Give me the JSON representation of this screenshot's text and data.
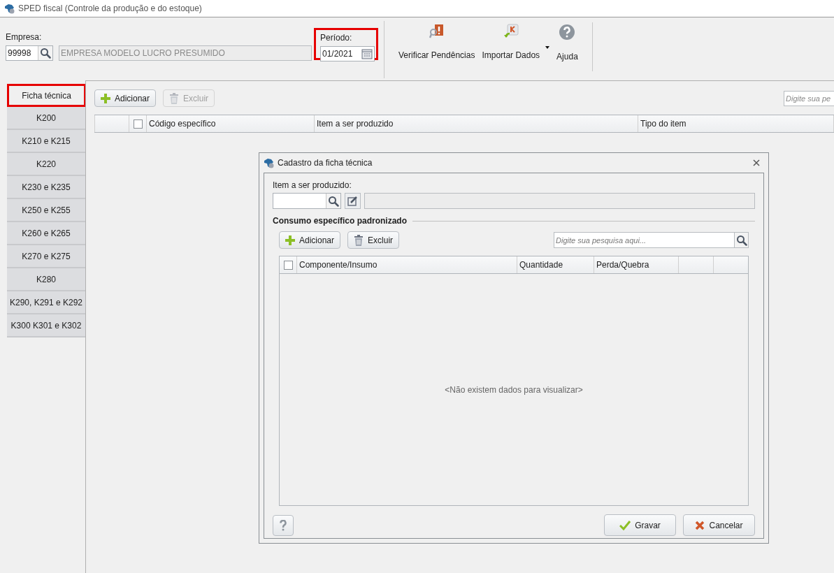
{
  "window": {
    "title": "SPED fiscal (Controle da produção e do estoque)"
  },
  "empresa": {
    "label": "Empresa:",
    "code": "99998",
    "name": "EMPRESA MODELO LUCRO PRESUMIDO"
  },
  "periodo": {
    "label": "Período:",
    "value": "01/2021",
    "highlighted": true
  },
  "toolbar": [
    {
      "kind": "pendencias",
      "label": "Verificar Pendências",
      "dropdown": false
    },
    {
      "kind": "import",
      "label": "Importar Dados",
      "dropdown": true
    },
    {
      "kind": "help",
      "label": "Ajuda",
      "dropdown": false
    }
  ],
  "side_tabs": [
    {
      "label": "Ficha técnica",
      "selected": true,
      "highlighted": true
    },
    {
      "label": "K200",
      "selected": false,
      "highlighted": false
    },
    {
      "label": "K210 e K215",
      "selected": false,
      "highlighted": false
    },
    {
      "label": "K220",
      "selected": false,
      "highlighted": false
    },
    {
      "label": "K230 e K235",
      "selected": false,
      "highlighted": false
    },
    {
      "label": "K250 e K255",
      "selected": false,
      "highlighted": false
    },
    {
      "label": "K260 e K265",
      "selected": false,
      "highlighted": false
    },
    {
      "label": "K270 e K275",
      "selected": false,
      "highlighted": false
    },
    {
      "label": "K280",
      "selected": false,
      "highlighted": false
    },
    {
      "label": "K290, K291 e K292",
      "selected": false,
      "highlighted": false
    },
    {
      "label": "K300 K301 e K302",
      "selected": false,
      "highlighted": false
    }
  ],
  "actions": [
    {
      "kind": "add",
      "label": "Adicionar",
      "disabled": false
    },
    {
      "kind": "delete",
      "label": "Excluir",
      "disabled": true
    }
  ],
  "search": {
    "placeholder": "Digite sua pe"
  },
  "table": {
    "columns": [
      "Código específico",
      "Item a ser produzido",
      "Tipo do item"
    ],
    "all_checked": false
  },
  "dialog": {
    "title": "Cadastro da ficha técnica",
    "item_label": "Item a ser produzido:",
    "section": "Consumo específico padronizado",
    "actions": [
      {
        "kind": "add",
        "label": "Adicionar",
        "disabled": false
      },
      {
        "kind": "delete",
        "label": "Excluir",
        "disabled": false
      }
    ],
    "search": {
      "placeholder": "Digite sua pesquisa aqui..."
    },
    "columns": [
      "Componente/Insumo",
      "Quantidade",
      "Perda/Quebra"
    ],
    "all_checked": false,
    "empty_message": "<Não existem dados para visualizar>",
    "buttons": [
      {
        "kind": "save",
        "label": "Gravar"
      },
      {
        "kind": "cancel",
        "label": "Cancelar"
      }
    ]
  }
}
